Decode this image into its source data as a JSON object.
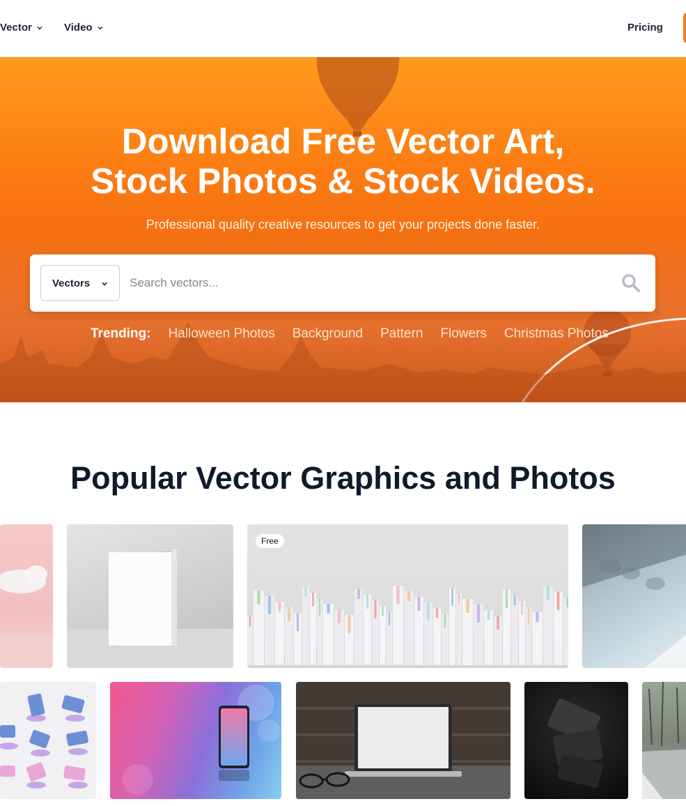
{
  "nav": {
    "items": [
      {
        "label": "Vector"
      },
      {
        "label": "Video"
      }
    ],
    "pricing_label": "Pricing"
  },
  "hero": {
    "title_line1": "Download Free Vector Art,",
    "title_line2": "Stock Photos & Stock Videos.",
    "subtitle": "Professional quality creative resources to get your projects done faster.",
    "search": {
      "type_selected": "Vectors",
      "placeholder": "Search vectors..."
    },
    "trending_label": "Trending:",
    "trending_links": [
      "Halloween Photos",
      "Background",
      "Pattern",
      "Flowers",
      "Christmas Photos"
    ]
  },
  "popular": {
    "title": "Popular Vector Graphics and Photos",
    "free_badge": "Free"
  },
  "colors": {
    "accent": "#f07f1a",
    "hero_orange": "#fb7a12",
    "heading": "#0f1b2a"
  },
  "icons": {
    "nav_chevron": "chevron-down-icon",
    "search": "search-icon"
  }
}
